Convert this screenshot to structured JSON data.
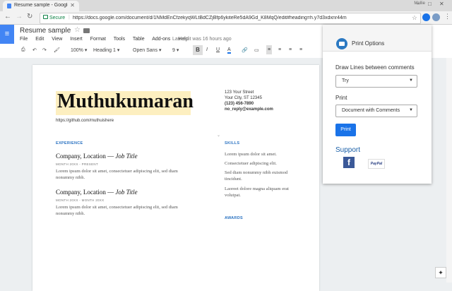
{
  "browser": {
    "tab_title": "Resume sample - Google Docs",
    "profile_name": "Mellie",
    "secure_label": "Secure",
    "url": "https://docs.google.com/document/d/1NMdEnCfzekyqWLtBdCZjBfp6ykiteRe5dA9Gd_K8MqQ/edit#heading=h.y7d3xdxnr44m"
  },
  "docs": {
    "title": "Resume sample",
    "menu": [
      "File",
      "Edit",
      "View",
      "Insert",
      "Format",
      "Tools",
      "Table",
      "Add-ons",
      "Help"
    ],
    "last_edit": "Last edit was 16 hours ago",
    "toolbar": {
      "zoom": "100%",
      "style": "Heading 1",
      "font": "Open Sans",
      "size": "9",
      "bold": "B",
      "italic": "I",
      "underline": "U",
      "text_color": "A"
    }
  },
  "resume": {
    "name": "Muthukumaran",
    "github": "https://github.com/muthuishere",
    "address": [
      "123 Your Street",
      "Your City, ST 12345",
      "(123) 456-7890",
      "no_reply@example.com"
    ],
    "experience_heading": "EXPERIENCE",
    "jobs": [
      {
        "title_plain": "Company, Location — ",
        "title_italic": "Job Title",
        "dates": "MONTH 20XX - PRESENT",
        "desc": "Lorem ipsum dolor sit amet, consectetuer adipiscing elit, sed diam nonummy nibh."
      },
      {
        "title_plain": "Company, Location — ",
        "title_italic": "Job Title",
        "dates": "MONTH 20XX - MONTH 20XX",
        "desc": "Lorem ipsum dolor sit amet, consectetuer adipiscing elit, sed diam nonummy nibh."
      }
    ],
    "skills_heading": "SKILLS",
    "skills": [
      "Lorem ipsum dolor sit amet.",
      "Consectetuer adipiscing elit.",
      "Sed diam nonummy nibh euismod tincidunt.",
      "Laoreet dolore magna aliquam erat volutpat."
    ],
    "awards_heading": "AWARDS"
  },
  "popup": {
    "title": "Print Options",
    "draw_lines_label": "Draw Lines between comments",
    "draw_lines_value": "Try",
    "print_label": "Print",
    "print_value": "Document with Comments",
    "print_button": "Print",
    "support_label": "Support",
    "paypal_label": "PayPal"
  },
  "colors": {
    "accent": "#1a73e8",
    "docs_blue": "#4285f4",
    "name_highlight": "#fdefc0",
    "section_heading": "#2b73c2"
  }
}
